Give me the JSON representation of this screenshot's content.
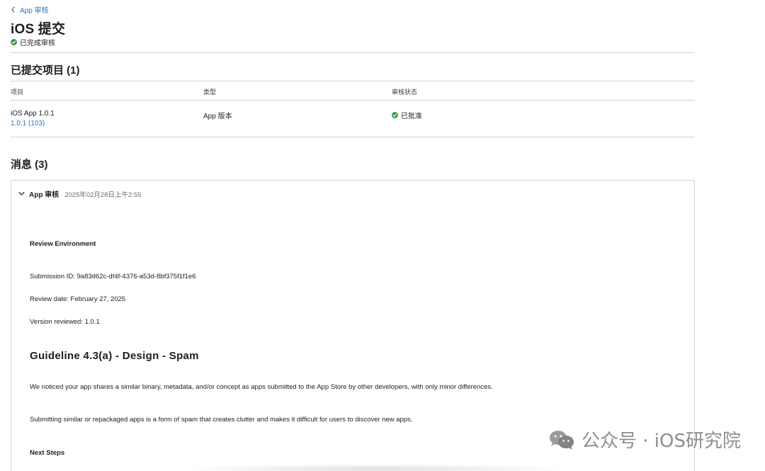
{
  "breadcrumb": {
    "label": "App 审核"
  },
  "page": {
    "title": "iOS 提交",
    "status": "已完成审核"
  },
  "submitted": {
    "section_title": "已提交项目 (1)",
    "columns": [
      "项目",
      "类型",
      "审核状态"
    ],
    "rows": [
      {
        "item_name": "iOS App 1.0.1",
        "build": "1.0.1 (103)",
        "type": "App 版本",
        "status": "已批准"
      }
    ]
  },
  "messages": {
    "section_title": "消息 (3)",
    "items": [
      {
        "sender": "App 审核",
        "timestamp": "2025年02月28日上午2:55",
        "review_env_heading": "Review Environment",
        "submission_id": "Submission ID: 9a83d62c-df4f-4376-a53d-8bf375f1f1e6",
        "review_date": "Review date: February 27, 2025",
        "version_reviewed": "Version reviewed: 1.0.1",
        "guideline_heading": "Guideline 4.3(a) - Design - Spam",
        "paragraph_1": "We noticed your app shares a similar binary, metadata, and/or concept as apps submitted to the App Store by other developers, with only minor differences.",
        "paragraph_2": "Submitting similar or repackaged apps is a form of spam that creates clutter and makes it difficult for users to discover new apps.",
        "next_steps_heading": "Next Steps"
      }
    ]
  },
  "watermark": {
    "text": "公众号 · iOS研究院"
  },
  "colors": {
    "link": "#2d74c4",
    "success": "#3a9d3e",
    "divider": "#d2d2d7",
    "text": "#1d1d1f"
  },
  "icons": {
    "breadcrumb": "chevron-left-icon",
    "status_ok": "check-circle-icon",
    "message_toggle": "chevron-down-icon",
    "watermark_logo": "wechat-icon"
  }
}
